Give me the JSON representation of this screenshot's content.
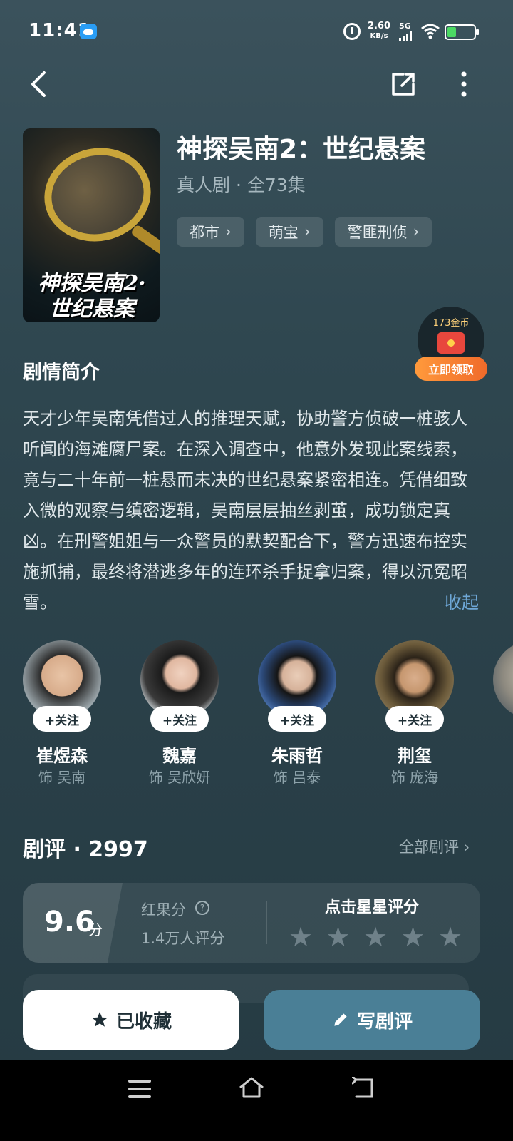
{
  "status_bar": {
    "time": "11:41",
    "speed_value": "2.60",
    "speed_unit": "KB/s",
    "network": "5G",
    "icons": [
      "weather-icon",
      "alarm-icon",
      "signal-icon",
      "wifi-icon",
      "battery-icon"
    ]
  },
  "nav": {
    "icons": [
      "back-arrow-icon",
      "share-icon",
      "more-vertical-icon"
    ]
  },
  "drama": {
    "poster_title": "神探吴南2·世纪悬案",
    "title": "神探吴南2：世纪悬案",
    "meta": "真人剧 · 全73集",
    "tags": [
      "都市",
      "萌宝",
      "警匪刑侦"
    ]
  },
  "coin_widget": {
    "amount": "173金币",
    "claim_label": "立即领取"
  },
  "synopsis": {
    "title": "剧情简介",
    "text": "天才少年吴南凭借过人的推理天赋，协助警方侦破一桩骇人听闻的海滩腐尸案。在深入调查中，他意外发现此案线索，竟与二十年前一桩悬而未决的世纪悬案紧密相连。凭借细致入微的观察与缜密逻辑，吴南层层抽丝剥茧，成功锁定真凶。在刑警姐姐与一众警员的默契配合下，警方迅速布控实施抓捕，最终将潜逃多年的连环杀手捉拿归案，得以沉冤昭雪。",
    "collapse_label": "收起"
  },
  "cast": {
    "follow_label": "+关注",
    "members": [
      {
        "name": "崔煜森",
        "role": "饰 吴南"
      },
      {
        "name": "魏嘉",
        "role": "饰 吴欣妍"
      },
      {
        "name": "朱雨哲",
        "role": "饰 吕泰"
      },
      {
        "name": "荆玺",
        "role": "饰 庞海"
      }
    ]
  },
  "reviews": {
    "title": "剧评 · 2997",
    "all_label": "全部剧评",
    "score": "9.6",
    "score_unit": "分",
    "score_label": "红果分",
    "score_count": "1.4万人评分",
    "rate_prompt": "点击星星评分",
    "stars_total": 5
  },
  "actions": {
    "collected_label": "已收藏",
    "write_review_label": "写剧评"
  },
  "colors": {
    "background": "#2f4750",
    "accent_blue": "#4a7f96",
    "link": "#6ea7d6",
    "coin_orange": "#f06a2a"
  }
}
